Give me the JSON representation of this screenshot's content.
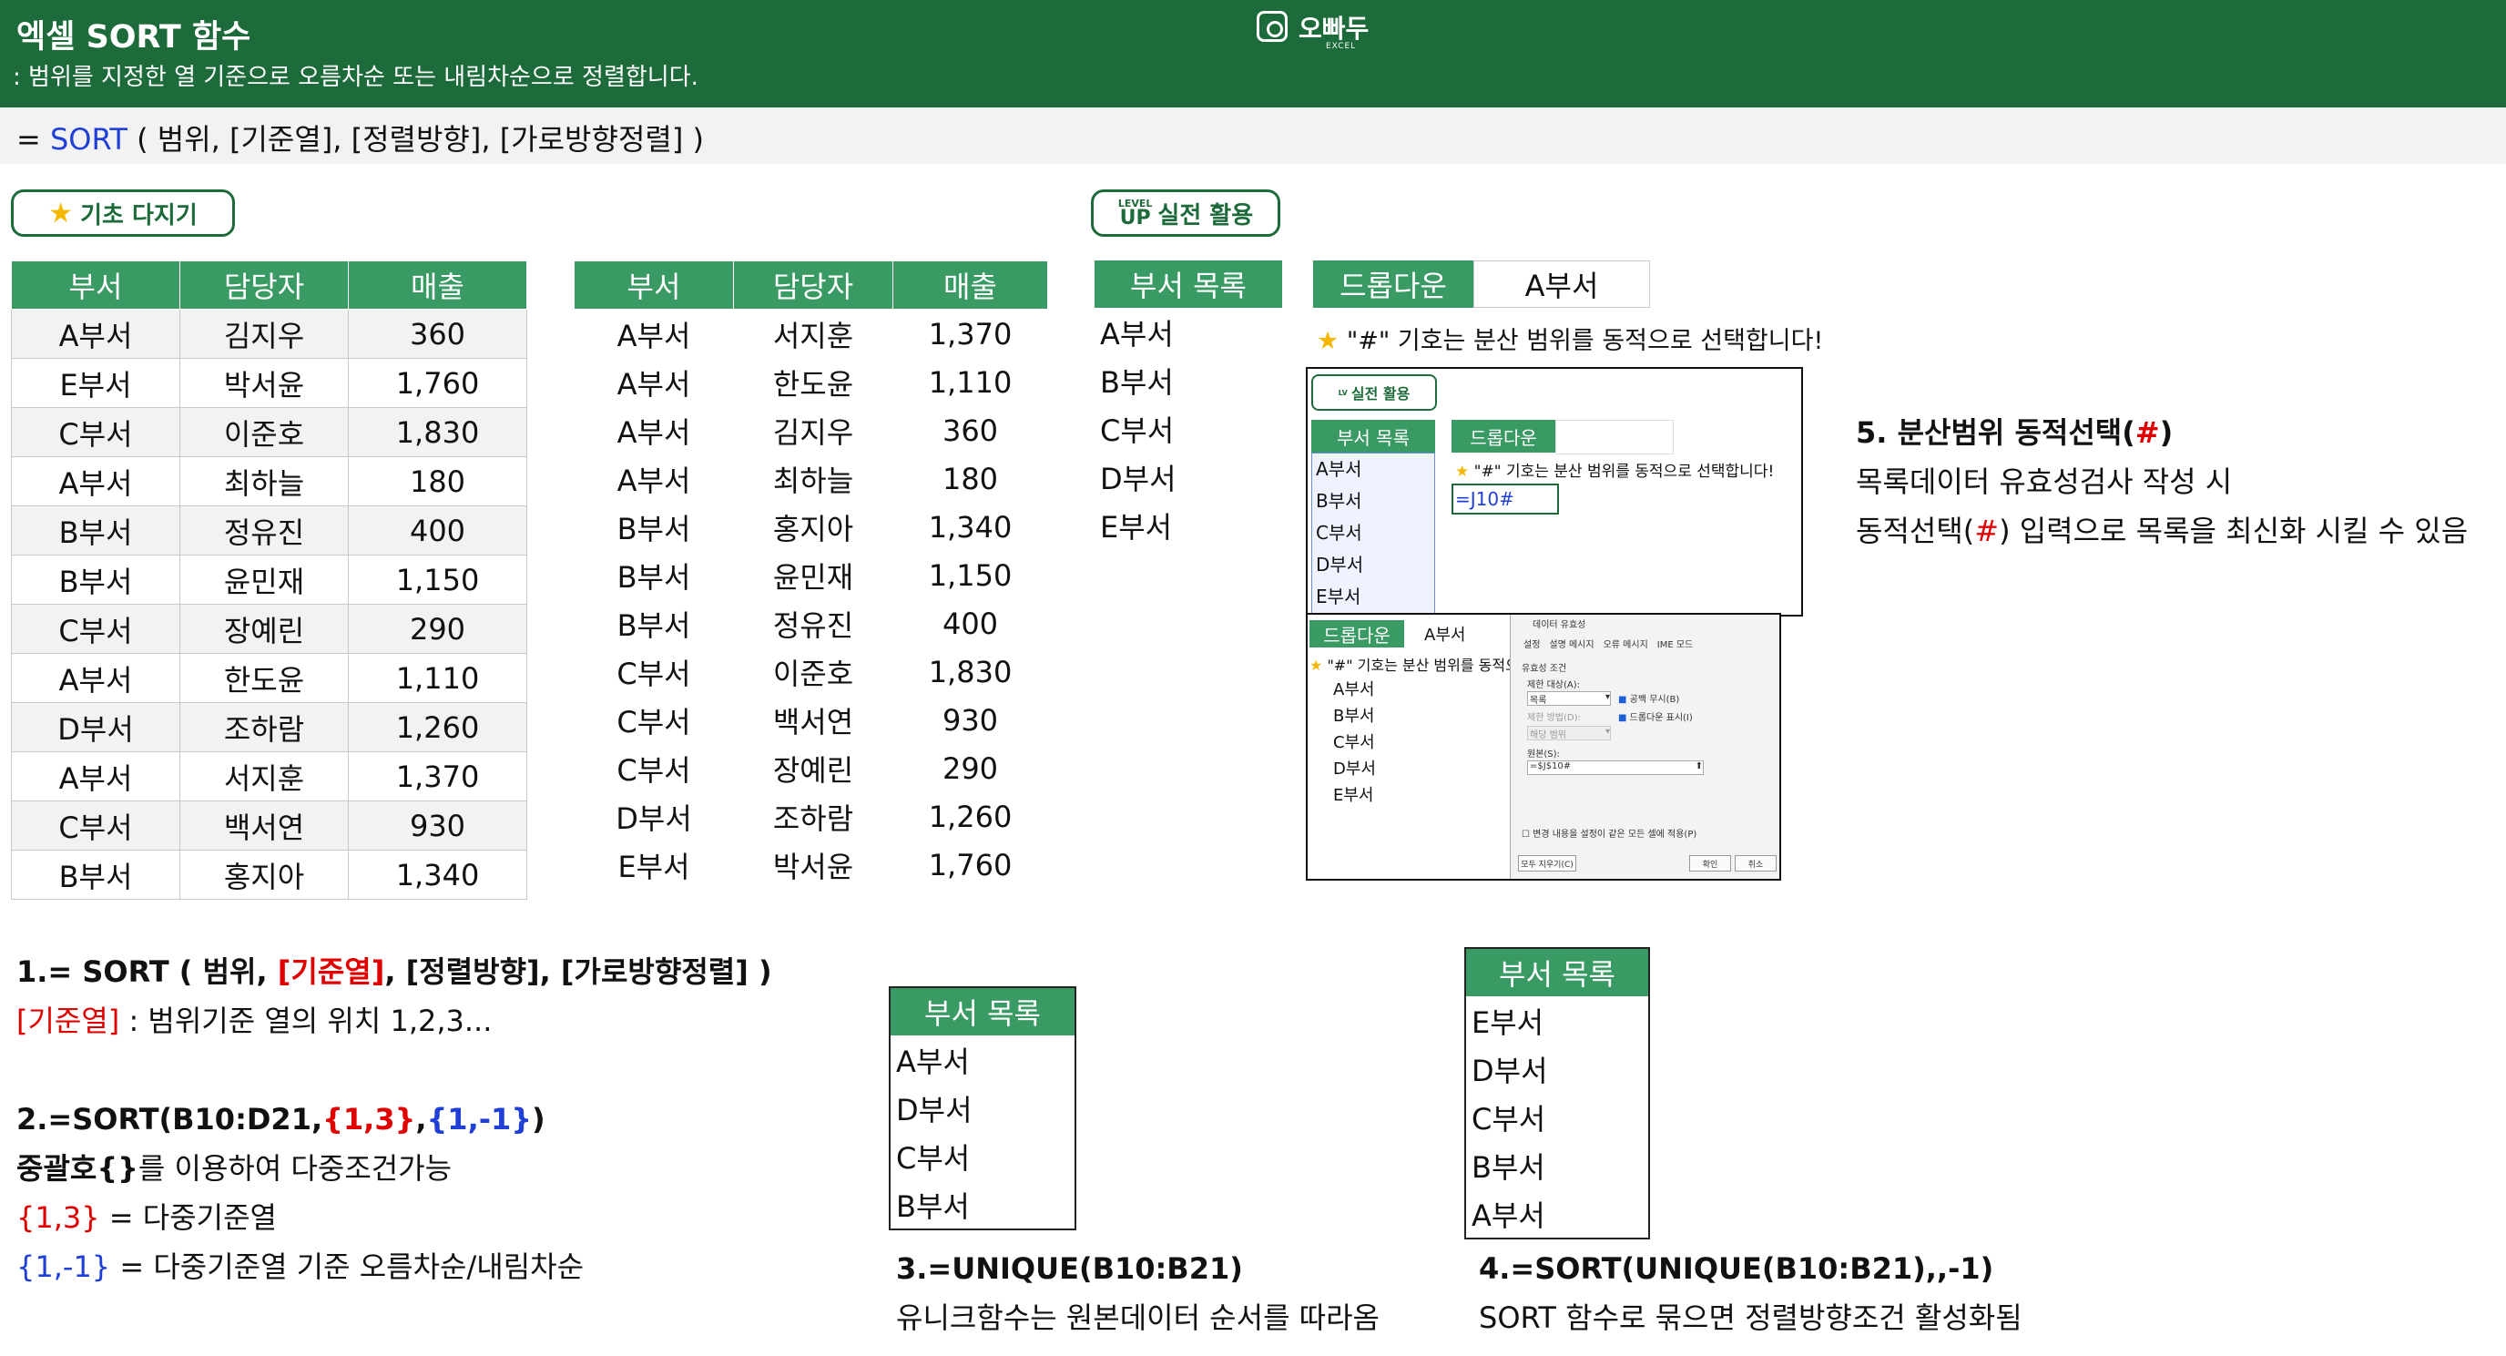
{
  "header": {
    "title": "엑셀 SORT 함수",
    "subtitle": ": 범위를 지정한 열 기준으로 오름차순 또는 내림차순으로 정렬합니다.",
    "logo_name": "오빠두",
    "logo_sub": "EXCEL"
  },
  "syntax": {
    "prefix": "= ",
    "fn": "SORT",
    "args": " ( 범위, [기준열], [정렬방향], [가로방향정렬] )"
  },
  "badges": {
    "basic": "기초 다지기",
    "level": "LEVEL",
    "up": "UP",
    "practical": "실전 활용"
  },
  "table_headers": [
    "부서",
    "담당자",
    "매출"
  ],
  "source_rows": [
    [
      "A부서",
      "김지우",
      "360"
    ],
    [
      "E부서",
      "박서윤",
      "1,760"
    ],
    [
      "C부서",
      "이준호",
      "1,830"
    ],
    [
      "A부서",
      "최하늘",
      "180"
    ],
    [
      "B부서",
      "정유진",
      "400"
    ],
    [
      "B부서",
      "윤민재",
      "1,150"
    ],
    [
      "C부서",
      "장예린",
      "290"
    ],
    [
      "A부서",
      "한도윤",
      "1,110"
    ],
    [
      "D부서",
      "조하람",
      "1,260"
    ],
    [
      "A부서",
      "서지훈",
      "1,370"
    ],
    [
      "C부서",
      "백서연",
      "930"
    ],
    [
      "B부서",
      "홍지아",
      "1,340"
    ]
  ],
  "sorted_rows": [
    [
      "A부서",
      "서지훈",
      "1,370"
    ],
    [
      "A부서",
      "한도윤",
      "1,110"
    ],
    [
      "A부서",
      "김지우",
      "360"
    ],
    [
      "A부서",
      "최하늘",
      "180"
    ],
    [
      "B부서",
      "홍지아",
      "1,340"
    ],
    [
      "B부서",
      "윤민재",
      "1,150"
    ],
    [
      "B부서",
      "정유진",
      "400"
    ],
    [
      "C부서",
      "이준호",
      "1,830"
    ],
    [
      "C부서",
      "백서연",
      "930"
    ],
    [
      "C부서",
      "장예린",
      "290"
    ],
    [
      "D부서",
      "조하람",
      "1,260"
    ],
    [
      "E부서",
      "박서윤",
      "1,760"
    ]
  ],
  "dept_list": {
    "header": "부서 목록",
    "items": [
      "A부서",
      "B부서",
      "C부서",
      "D부서",
      "E부서"
    ]
  },
  "dropdown": {
    "label": "드롭다운",
    "value": "A부서",
    "note": "\"#\" 기호는 분산 범위를 동적으로 선택합니다!"
  },
  "mini1": {
    "badge": "실전 활용",
    "list_header": "부서 목록",
    "dd_label": "드롭다운",
    "formula": "=J10#"
  },
  "mini2": {
    "dd_label": "드롭다운",
    "dd_value": "A부서",
    "note": "\"#\" 기호는 분산 범위를 동적으",
    "dialog_title": "데이터 유효성",
    "tabs": [
      "설정",
      "설명 메시지",
      "오류 메시지",
      "IME 모드"
    ],
    "section": "유효성 조건",
    "allow_label": "제한 대상(A):",
    "allow_value": "목록",
    "data_label": "제한 방법(D):",
    "data_value": "해당 범위",
    "cb1": "공백 무시(B)",
    "cb2": "드롭다운 표시(I)",
    "source_label": "원본(S):",
    "source_value": "=$J$10#",
    "apply_all": "변경 내용을 설정이 같은 모든 셀에 적용(P)",
    "clear": "모두 지우기(C)",
    "ok": "확인",
    "cancel": "취소"
  },
  "tip5": {
    "title_pre": "5. 분산범위 동적선택(",
    "title_hash": "#",
    "title_post": ")",
    "line1": "목록데이터 유효성검사 작성 시",
    "line2_pre": "동적선택(",
    "line2_hash": "#",
    "line2_post": ") 입력으로 목록을 최신화 시킬 수 있음"
  },
  "tip1": {
    "pre": "1.= SORT ( 범위, ",
    "key": "[기준열]",
    "post": ", [정렬방향], [가로방향정렬] )",
    "desc_key": "[기준열]",
    "desc": " : 범위기준 열의 위치 1,2,3..."
  },
  "tip2": {
    "pre": "2.=SORT(B10:D21,",
    "arg1": "{1,3}",
    "comma": ",",
    "arg2": "{1,-1}",
    "post": ")",
    "line1_bold": "중괄호{}",
    "line1": "를 이용하여 다중조건가능",
    "line2_key": "{1,3}",
    "line2": " = 다중기준열",
    "line3_key": "{1,-1}",
    "line3": " = 다중기준열 기준 오름차순/내림차순"
  },
  "unique_list": {
    "header": "부서 목록",
    "items": [
      "A부서",
      "D부서",
      "C부서",
      "B부서"
    ]
  },
  "tip3": {
    "title": "3.=UNIQUE(B10:B21)",
    "desc": "유니크함수는 원본데이터 순서를 따라옴"
  },
  "sorted_unique_list": {
    "header": "부서 목록",
    "items": [
      "E부서",
      "D부서",
      "C부서",
      "B부서",
      "A부서"
    ]
  },
  "tip4": {
    "title": "4.=SORT(UNIQUE(B10:B21),,-1)",
    "desc": "SORT 함수로 묶으면 정렬방향조건 활성화됨"
  },
  "colors": {
    "brand": "#1d6b3a",
    "table_header": "#3a9a63",
    "accent_red": "#e00000",
    "accent_blue": "#1f3fd6"
  }
}
